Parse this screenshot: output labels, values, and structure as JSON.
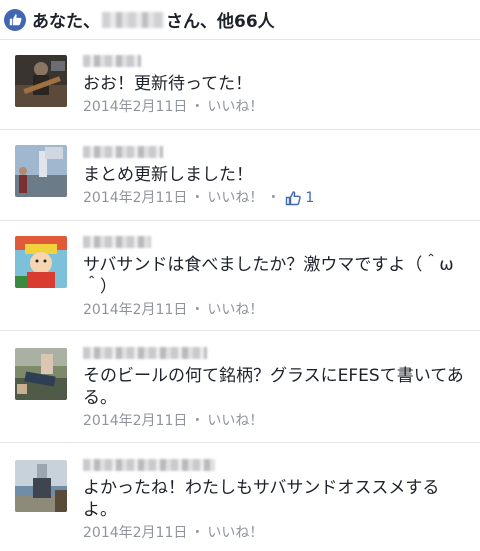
{
  "likes_header": {
    "prefix": "あなた、",
    "suffix": "さん、他66人"
  },
  "comments": [
    {
      "text": "おお！更新待ってた！",
      "date": "2014年2月11日",
      "like_label": "いいね！",
      "like_count": ""
    },
    {
      "text": "まとめ更新しました！",
      "date": "2014年2月11日",
      "like_label": "いいね！",
      "like_count": "1"
    },
    {
      "text": "サバサンドは食べましたか？激ウマですよ（＾ω＾）",
      "date": "2014年2月11日",
      "like_label": "いいね！",
      "like_count": ""
    },
    {
      "text": "そのビールの何て銘柄？グラスにEFESて書いてある。",
      "date": "2014年2月11日",
      "like_label": "いいね！",
      "like_count": ""
    },
    {
      "text": "よかったね！わたしもサバサンドオススメするよ。",
      "date": "2014年2月11日",
      "like_label": "いいね！",
      "like_count": ""
    }
  ],
  "colors": {
    "accent": "#4267b2",
    "meta_text": "#90949c",
    "divider": "#e5e5e8"
  },
  "icons": {
    "likes_header": "thumbs-up-icon",
    "comment_like": "thumbs-up-outline-icon"
  }
}
